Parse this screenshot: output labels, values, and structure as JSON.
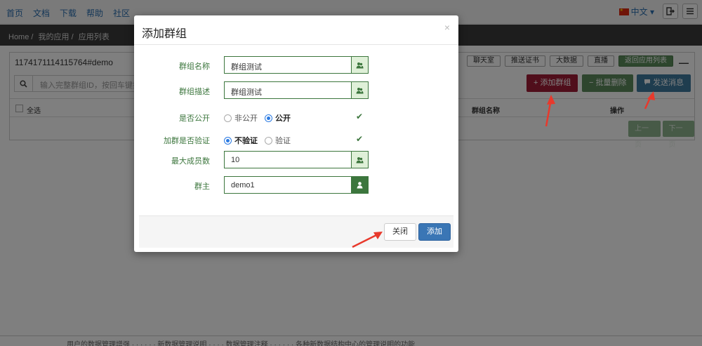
{
  "topnav": {
    "links": [
      "首页",
      "文档",
      "下载",
      "帮助",
      "社区"
    ],
    "lang": "中文",
    "lang_caret": "▾"
  },
  "breadcrumb": [
    "Home /",
    "我的应用 /",
    "应用列表"
  ],
  "panel": {
    "title": "1174171114115764#demo",
    "toolbar": [
      "聊天室",
      "推送证书",
      "大数据",
      "直播",
      "返回应用列表"
    ],
    "collapse": "—",
    "search_placeholder": "输入完整群组ID，按回车键搜",
    "actions": {
      "add_group": "+ 添加群组",
      "batch_delete": "− 批量删除",
      "send_message": "发送消息"
    },
    "table_headers": {
      "select_all": "全选",
      "group_name": "群组名称",
      "operation": "操作"
    },
    "pager": {
      "prev": "上一页",
      "next": "下一页"
    }
  },
  "footer": {
    "text": "用户的数据管理增强  ·  ·  ·  ·  ·  ·  新数据管理说明  ·  ·  ·  ·  数据管理注释  ·  ·  ·  ·  ·  ·  各种新数据结构中心的管理说明的功能"
  },
  "modal": {
    "title": "添加群组",
    "close_symbol": "×",
    "fields": {
      "group_name": {
        "label": "群组名称",
        "value": "群组测试"
      },
      "group_desc": {
        "label": "群组描述",
        "value": "群组测试"
      },
      "is_public": {
        "label": "是否公开",
        "options": [
          "非公开",
          "公开"
        ],
        "selected": "公开"
      },
      "need_verify": {
        "label": "加群是否验证",
        "options": [
          "不验证",
          "验证"
        ],
        "selected": "不验证"
      },
      "max_members": {
        "label": "最大成员数",
        "value": "10"
      },
      "owner": {
        "label": "群主",
        "value": "demo1"
      }
    },
    "buttons": {
      "close": "关闭",
      "submit": "添加"
    }
  },
  "colors": {
    "success_green": "#3c763d",
    "primary_blue": "#3a76b5",
    "danger_red": "#a01d36",
    "arrow_red": "#e8392c"
  }
}
